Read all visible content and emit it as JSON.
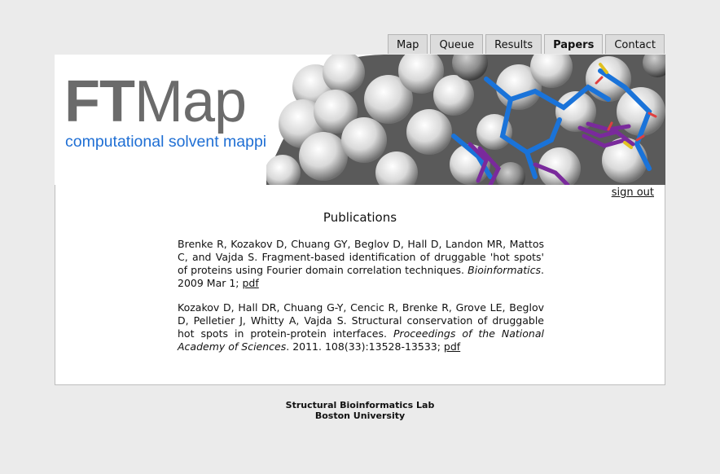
{
  "nav": {
    "tabs": [
      {
        "label": "Map"
      },
      {
        "label": "Queue"
      },
      {
        "label": "Results"
      },
      {
        "label": "Papers",
        "active": true
      },
      {
        "label": "Contact"
      }
    ]
  },
  "banner": {
    "logo_bold": "FT",
    "logo_rest": "Map",
    "tagline": "computational solvent mapping"
  },
  "header": {
    "signout": "sign out"
  },
  "main": {
    "title": "Publications",
    "publications": [
      {
        "authors_text": "Brenke R, Kozakov D, Chuang GY, Beglov D, Hall D, Landon MR, Mattos C, and Vajda S. Fragment-based identification of druggable 'hot spots' of proteins using Fourier domain correlation techniques.",
        "journal": "Bioinformatics",
        "details": ". 2009 Mar 1; ",
        "link": "pdf"
      },
      {
        "authors_text": "Kozakov D, Hall DR, Chuang G-Y, Cencic R, Brenke R, Grove LE, Beglov D, Pelletier J, Whitty A, Vajda S. Structural conservation of druggable hot spots in protein-protein interfaces. ",
        "journal": "Proceedings of the National Academy of Sciences",
        "details": ". 2011. 108(33):13528-13533; ",
        "link": "pdf"
      }
    ]
  },
  "footer": {
    "line1": "Structural Bioinformatics Lab",
    "line2": "Boston University"
  },
  "colors": {
    "page_bg": "#ebebeb",
    "tagline": "#1f6fd4",
    "logo": "#6b6b6b"
  }
}
